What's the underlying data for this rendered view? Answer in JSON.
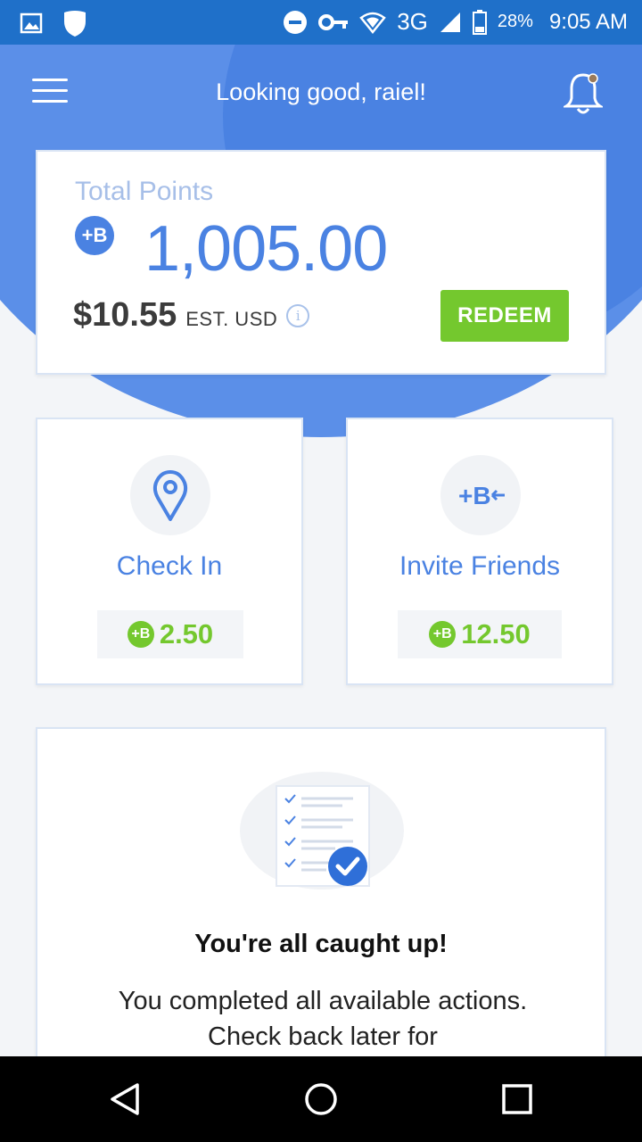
{
  "status_bar": {
    "network": "3G",
    "battery": "28%",
    "time": "9:05 AM",
    "icons": [
      "image-icon",
      "shield-icon",
      "do-not-disturb-icon",
      "vpn-key-icon",
      "wifi-icon",
      "signal-icon",
      "battery-icon"
    ]
  },
  "header": {
    "greeting": "Looking good, raiel!"
  },
  "points": {
    "label": "Total Points",
    "value": "1,005.00",
    "usd_amount": "$10.55",
    "usd_label": "EST. USD",
    "redeem_label": "REDEEM",
    "coin_icon": "points-coin-icon"
  },
  "actions": [
    {
      "title": "Check In",
      "reward": "2.50",
      "icon": "location-pin-icon"
    },
    {
      "title": "Invite Friends",
      "reward": "12.50",
      "icon": "invite-points-icon"
    }
  ],
  "caught_up": {
    "title": "You're all caught up!",
    "body": "You completed all available actions. Check back later for"
  },
  "colors": {
    "primary_blue": "#4a82e2",
    "status_bar": "#1f70c9",
    "reward_green": "#74c82e"
  }
}
